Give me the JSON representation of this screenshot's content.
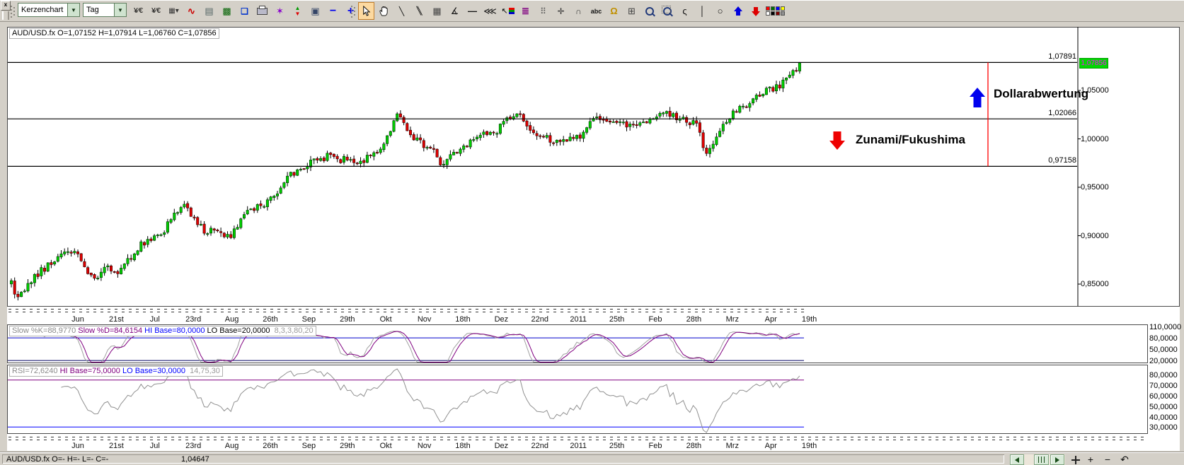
{
  "toolbar": {
    "close_glyph": "x",
    "chart_type": "Kerzenchart",
    "period": "Tag",
    "icons_a": [
      {
        "name": "currency-format-icon",
        "glyph": "¥⁄€",
        "color": "#000",
        "size": 10
      },
      {
        "name": "currency-format-alt-icon",
        "glyph": "¥⁄€",
        "color": "#000",
        "size": 10
      },
      {
        "name": "grid-style-icon",
        "glyph": "▦▾",
        "color": "#333",
        "size": 10
      },
      {
        "name": "indicator-icon",
        "glyph": "∿",
        "color": "#cc0000",
        "size": 13,
        "bold": true
      },
      {
        "name": "chart-template-icon",
        "glyph": "▤",
        "color": "#566",
        "size": 13
      },
      {
        "name": "chart-screen-icon",
        "glyph": "▩",
        "color": "#056405",
        "size": 13
      },
      {
        "name": "save-layout-icon",
        "glyph": "❏",
        "color": "#0033cc",
        "size": 12,
        "bold": true
      },
      {
        "name": "print-icon",
        "kind": "printer"
      },
      {
        "name": "draw-star-icon",
        "glyph": "✶",
        "color": "#8800cc",
        "size": 13
      },
      {
        "name": "updown-signals-icon",
        "kind": "updown"
      },
      {
        "name": "monitor-icon",
        "glyph": "▣",
        "color": "#334466",
        "size": 13
      },
      {
        "name": "zoom-out-icon",
        "glyph": "−",
        "color": "#0000ee",
        "size": 16,
        "bold": true
      },
      {
        "name": "zoom-in-icon",
        "glyph": "+",
        "color": "#0000ee",
        "size": 16,
        "bold": true
      }
    ],
    "icons_b": [
      {
        "name": "select-cursor-icon",
        "kind": "cursor",
        "selected": true
      },
      {
        "name": "pan-hand-icon",
        "kind": "hand"
      },
      {
        "name": "trendline-icon",
        "glyph": "╲",
        "color": "#111",
        "size": 12
      },
      {
        "name": "parallel-lines-icon",
        "glyph": "╲╲",
        "color": "#111",
        "size": 11,
        "tight": true
      },
      {
        "name": "fine-grid-icon",
        "glyph": "▦",
        "color": "#444",
        "size": 13
      },
      {
        "name": "fan-lines-icon",
        "glyph": "∡",
        "color": "#111",
        "size": 13
      },
      {
        "name": "horizontal-line-icon",
        "glyph": "—",
        "color": "#111",
        "size": 13,
        "bold": true
      },
      {
        "name": "speed-lines-icon",
        "glyph": "⋘",
        "color": "#111",
        "size": 13
      },
      {
        "name": "pointer-color-icon",
        "kind": "cursor-rgb"
      },
      {
        "name": "text-style-icon",
        "glyph": "≣",
        "color": "#800080",
        "size": 13,
        "bold": true
      },
      {
        "name": "dot-grid-icon",
        "glyph": "⠿",
        "color": "#555",
        "size": 12
      },
      {
        "name": "crosshair-icon",
        "glyph": "✛",
        "color": "#333",
        "size": 12
      },
      {
        "name": "fib-arcs-icon",
        "glyph": "∩",
        "color": "#333",
        "size": 12,
        "bold": true
      },
      {
        "name": "text-abc-icon",
        "glyph": "abc",
        "color": "#111",
        "size": 9,
        "bold": true
      },
      {
        "name": "alert-bell-icon",
        "glyph": "Ω",
        "color": "#c09000",
        "size": 13,
        "bold": true
      },
      {
        "name": "calculator-icon",
        "glyph": "⊞",
        "color": "#444",
        "size": 13
      },
      {
        "name": "zoom-lens-icon",
        "kind": "lens"
      },
      {
        "name": "zoom-area-icon",
        "kind": "lens-area"
      },
      {
        "name": "freehand-icon",
        "glyph": "ς",
        "color": "#111",
        "size": 13
      },
      {
        "name": "vertical-line-icon",
        "glyph": "│",
        "color": "#111",
        "size": 13
      },
      {
        "name": "ellipse-icon",
        "glyph": "○",
        "color": "#111",
        "size": 13
      },
      {
        "name": "arrow-up-icon",
        "kind": "arrow",
        "dir": "up",
        "color": "#0000dd"
      },
      {
        "name": "arrow-down-icon",
        "kind": "arrow",
        "dir": "down",
        "color": "#dd0000"
      },
      {
        "name": "palette-icon",
        "kind": "palette",
        "colors": [
          "#ff0000",
          "#007000",
          "#0000ff",
          "#ffff00",
          "#ffffff",
          "#000000",
          "#800000",
          "#909090"
        ]
      }
    ]
  },
  "chart": {
    "title": "AUD/USD.fx O=1,07152 H=1,07914 L=1,06760 C=1,07856",
    "current_price": {
      "text": "1,07856",
      "bg": "#00d800",
      "fg": "#ff00ff"
    },
    "price_axis": {
      "labels": [
        "1,05000",
        "1,00000",
        "0,95000",
        "0,90000",
        "0,85000"
      ],
      "values": [
        1.05,
        1.0,
        0.95,
        0.9,
        0.85
      ]
    },
    "hlines": [
      {
        "label": "1,07891",
        "value": 1.07891
      },
      {
        "label": "1,02066",
        "value": 1.02066
      },
      {
        "label": "0,97158",
        "value": 0.97158
      }
    ],
    "annotations": {
      "up": {
        "text": "Dollarabwertung",
        "arrow_color": "#0000ee"
      },
      "down": {
        "text": "Zunami/Fukushima",
        "arrow_color": "#ee0000"
      },
      "vline_color": "#ff0000"
    },
    "x_labels": [
      "Jun",
      "21st",
      "Jul",
      "23rd",
      "Aug",
      "26th",
      "Sep",
      "29th",
      "Okt",
      "Nov",
      "18th",
      "Dez",
      "22nd",
      "2011",
      "25th",
      "Feb",
      "28th",
      "Mrz",
      "Apr",
      "19th"
    ],
    "colors": {
      "up_fill": "#00cf00",
      "up_stroke": "#003300",
      "down_fill": "#e00000",
      "down_stroke": "#330000",
      "wick": "#000000"
    }
  },
  "chart_data": {
    "type": "candlestick",
    "symbol": "AUD/USD.fx",
    "period": "Tag",
    "ohlc_last": {
      "open": "1,07152",
      "high": "1,07914",
      "low": "1,06760",
      "close": "1,07856"
    },
    "y_axis_range": [
      0.8274,
      1.1157
    ],
    "levels": [
      1.07891,
      1.02066,
      0.97158
    ],
    "x_tick_labels": [
      "Jun",
      "21st",
      "Jul",
      "23rd",
      "Aug",
      "26th",
      "Sep",
      "29th",
      "Okt",
      "Nov",
      "18th",
      "Dez",
      "22nd",
      "2011",
      "25th",
      "Feb",
      "28th",
      "Mrz",
      "Apr",
      "19th"
    ],
    "trend_waypoints": {
      "x": [
        15,
        25,
        40,
        60,
        75,
        95,
        110,
        125,
        135,
        150,
        165,
        180,
        200,
        215,
        230,
        245,
        262,
        275,
        290,
        305,
        318,
        330,
        345,
        360,
        375,
        390,
        405,
        420,
        435,
        450,
        465,
        480,
        495,
        505,
        520,
        535,
        550,
        560,
        572,
        585,
        600,
        615,
        625,
        640,
        655,
        670,
        685,
        700,
        715,
        730,
        745,
        760,
        775,
        790,
        805,
        820,
        835,
        850,
        865,
        880,
        895,
        910,
        925,
        940,
        955,
        970,
        985,
        995,
        1010,
        1025,
        1040,
        1055,
        1070,
        1085,
        1100,
        1115,
        1130,
        1135
      ],
      "price": [
        0.852,
        0.833,
        0.85,
        0.865,
        0.873,
        0.886,
        0.88,
        0.862,
        0.855,
        0.869,
        0.861,
        0.873,
        0.891,
        0.895,
        0.902,
        0.922,
        0.933,
        0.916,
        0.903,
        0.909,
        0.897,
        0.903,
        0.923,
        0.927,
        0.934,
        0.942,
        0.96,
        0.967,
        0.974,
        0.978,
        0.983,
        0.978,
        0.98,
        0.976,
        0.98,
        0.985,
        1.007,
        1.026,
        1.015,
        1.0,
        0.993,
        0.985,
        0.971,
        0.985,
        0.993,
        1.0,
        1.004,
        1.007,
        1.018,
        1.029,
        1.015,
        1.004,
        1.0,
        0.996,
        1.0,
        1.004,
        1.018,
        1.022,
        1.015,
        1.018,
        1.011,
        1.018,
        1.022,
        1.026,
        1.022,
        1.018,
        1.015,
        0.985,
        1.0,
        1.018,
        1.029,
        1.036,
        1.044,
        1.051,
        1.054,
        1.065,
        1.076,
        1.079
      ]
    }
  },
  "stochastic": {
    "title_parts": [
      {
        "text": "Slow %K=88,9770",
        "color": "#8a8a8a"
      },
      {
        "text": " Slow %D=84,6154",
        "color": "#800080"
      },
      {
        "text": " HI Base=80,0000",
        "color": "#0000ff"
      },
      {
        "text": " LO Base=20,0000",
        "color": "#000000"
      },
      {
        "text": "  8,3,3,80,20",
        "color": "#9a9a9a"
      }
    ],
    "axis": {
      "labels": [
        "110,0000",
        "80,0000",
        "50,0000",
        "20,0000"
      ],
      "values": [
        110,
        80,
        50,
        20
      ]
    },
    "hi_level": 80,
    "lo_level": 20,
    "k_color": "#a0a0a0",
    "d_color": "#800080",
    "hi_color": "#0000cc",
    "lo_color": "#000060"
  },
  "rsi": {
    "title_parts": [
      {
        "text": "RSI=72,6240",
        "color": "#8a8a8a"
      },
      {
        "text": " HI Base=75,0000",
        "color": "#800080"
      },
      {
        "text": " LO Base=30,0000",
        "color": "#0000ff"
      },
      {
        "text": "  14,75,30",
        "color": "#9a9a9a"
      }
    ],
    "axis": {
      "labels": [
        "80,0000",
        "70,0000",
        "60,0000",
        "50,0000",
        "40,0000",
        "30,0000"
      ],
      "values": [
        80,
        70,
        60,
        50,
        40,
        30
      ]
    },
    "hi_level": 75,
    "lo_level": 30,
    "line_color": "#909090",
    "hi_color": "#800080",
    "lo_color": "#0000ff"
  },
  "statusbar": {
    "left": "AUD/USD.fx O=- H=- L=- C=-",
    "value": "1,04647",
    "controls": [
      "scroll-left",
      "scroll-thumb",
      "scroll-right",
      "pan-cross",
      "zoom-in",
      "zoom-out",
      "undo"
    ]
  }
}
